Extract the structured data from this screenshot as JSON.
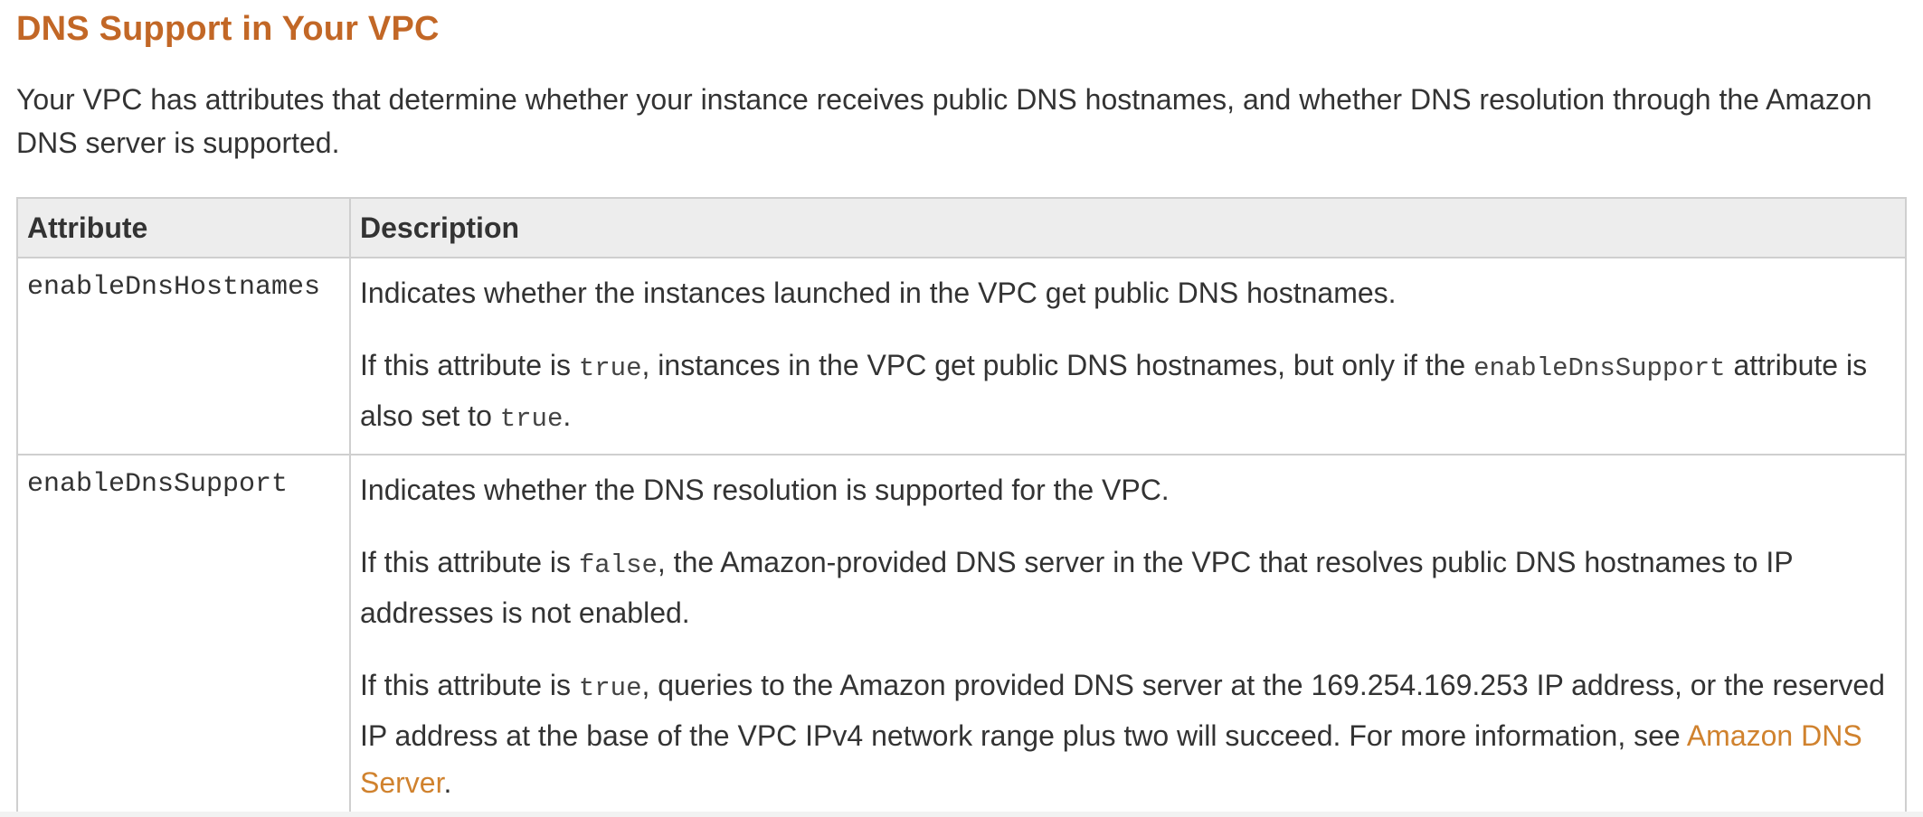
{
  "heading": "DNS Support in Your VPC",
  "intro": "Your VPC has attributes that determine whether your instance receives public DNS hostnames, and whether DNS resolution through the Amazon DNS server is supported.",
  "table": {
    "headers": {
      "attribute": "Attribute",
      "description": "Description"
    },
    "rows": [
      {
        "name": "enableDnsHostnames",
        "p1": "Indicates whether the instances launched in the VPC get public DNS hostnames.",
        "p2": {
          "t1": "If this attribute is ",
          "c1": "true",
          "t2": ", instances in the VPC get public DNS hostnames, but only if the ",
          "c2": "enableDnsSupport",
          "t3": " attribute is also set to ",
          "c3": "true",
          "t4": "."
        }
      },
      {
        "name": "enableDnsSupport",
        "p1": "Indicates whether the DNS resolution is supported for the VPC.",
        "p2": {
          "t1": "If this attribute is ",
          "c1": "false",
          "t2": ", the Amazon-provided DNS server in the VPC that resolves public DNS hostnames to IP addresses is not enabled."
        },
        "p3": {
          "t1": "If this attribute is ",
          "c1": "true",
          "t2": ", queries to the Amazon provided DNS server at the 169.254.169.253 IP address, or the reserved IP address at the base of the VPC IPv4 network range plus two will succeed. For more information, see ",
          "link": "Amazon DNS Server",
          "t3": "."
        }
      }
    ]
  },
  "colors": {
    "heading": "#c26726",
    "link": "#d0822e",
    "header_bg": "#ededed",
    "border": "#cfcfcf"
  }
}
